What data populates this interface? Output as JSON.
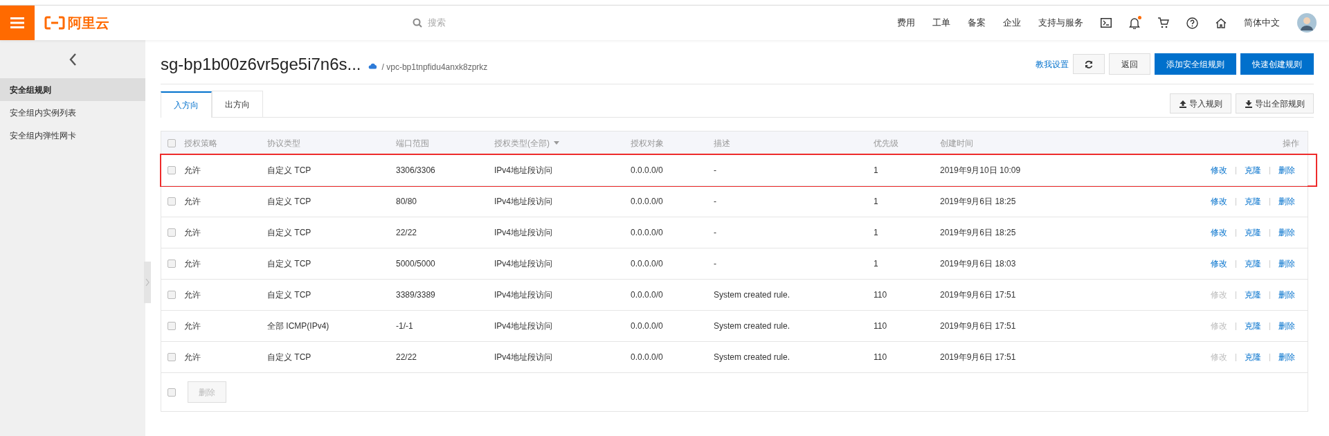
{
  "topbar": {
    "logo": "阿里云",
    "search_placeholder": "搜索",
    "nav": [
      "费用",
      "工单",
      "备案",
      "企业",
      "支持与服务"
    ],
    "notification_dot": true,
    "language": "简体中文"
  },
  "sidebar": {
    "items": [
      {
        "label": "安全组规则",
        "selected": true
      },
      {
        "label": "安全组内实例列表",
        "selected": false
      },
      {
        "label": "安全组内弹性网卡",
        "selected": false
      }
    ]
  },
  "header": {
    "title": "sg-bp1b00z6vr5ge5i7n6s...",
    "vpc": "/ vpc-bp1tnpfidu4anxk8zprkz",
    "help_link": "教我设置",
    "buttons": [
      {
        "label": "返回",
        "kind": "plain"
      },
      {
        "label": "添加安全组规则",
        "kind": "primary"
      },
      {
        "label": "快速创建规则",
        "kind": "primary"
      }
    ]
  },
  "tabs": [
    {
      "label": "入方向",
      "selected": true
    },
    {
      "label": "出方向",
      "selected": false
    }
  ],
  "tools": [
    {
      "label": "导入规则",
      "kind": "upload"
    },
    {
      "label": "导出全部规则",
      "kind": "download"
    }
  ],
  "table": {
    "select_all_checked": false,
    "columns": [
      "授权策略",
      "协议类型",
      "端口范围",
      "授权类型(全部)",
      "授权对象",
      "描述",
      "优先级",
      "创建时间",
      "操作"
    ],
    "rows": [
      {
        "checked": false,
        "highlighted": true,
        "cells": [
          "允许",
          "自定义 TCP",
          "3306/3306",
          "IPv4地址段访问",
          "0.0.0.0/0",
          "-",
          "1",
          "2019年9月10日 10:09"
        ],
        "actions": [
          {
            "label": "修改",
            "disabled": false
          },
          {
            "label": "克隆",
            "disabled": false
          },
          {
            "label": "删除",
            "disabled": false
          }
        ]
      },
      {
        "checked": false,
        "highlighted": false,
        "cells": [
          "允许",
          "自定义 TCP",
          "80/80",
          "IPv4地址段访问",
          "0.0.0.0/0",
          "-",
          "1",
          "2019年9月6日 18:25"
        ],
        "actions": [
          {
            "label": "修改",
            "disabled": false
          },
          {
            "label": "克隆",
            "disabled": false
          },
          {
            "label": "删除",
            "disabled": false
          }
        ]
      },
      {
        "checked": false,
        "highlighted": false,
        "cells": [
          "允许",
          "自定义 TCP",
          "22/22",
          "IPv4地址段访问",
          "0.0.0.0/0",
          "-",
          "1",
          "2019年9月6日 18:25"
        ],
        "actions": [
          {
            "label": "修改",
            "disabled": false
          },
          {
            "label": "克隆",
            "disabled": false
          },
          {
            "label": "删除",
            "disabled": false
          }
        ]
      },
      {
        "checked": false,
        "highlighted": false,
        "cells": [
          "允许",
          "自定义 TCP",
          "5000/5000",
          "IPv4地址段访问",
          "0.0.0.0/0",
          "-",
          "1",
          "2019年9月6日 18:03"
        ],
        "actions": [
          {
            "label": "修改",
            "disabled": false
          },
          {
            "label": "克隆",
            "disabled": false
          },
          {
            "label": "删除",
            "disabled": false
          }
        ]
      },
      {
        "checked": false,
        "highlighted": false,
        "cells": [
          "允许",
          "自定义 TCP",
          "3389/3389",
          "IPv4地址段访问",
          "0.0.0.0/0",
          "System created rule.",
          "110",
          "2019年9月6日 17:51"
        ],
        "actions": [
          {
            "label": "修改",
            "disabled": true
          },
          {
            "label": "克隆",
            "disabled": false
          },
          {
            "label": "删除",
            "disabled": false
          }
        ]
      },
      {
        "checked": false,
        "highlighted": false,
        "cells": [
          "允许",
          "全部 ICMP(IPv4)",
          "-1/-1",
          "IPv4地址段访问",
          "0.0.0.0/0",
          "System created rule.",
          "110",
          "2019年9月6日 17:51"
        ],
        "actions": [
          {
            "label": "修改",
            "disabled": true
          },
          {
            "label": "克隆",
            "disabled": false
          },
          {
            "label": "删除",
            "disabled": false
          }
        ]
      },
      {
        "checked": false,
        "highlighted": false,
        "cells": [
          "允许",
          "自定义 TCP",
          "22/22",
          "IPv4地址段访问",
          "0.0.0.0/0",
          "System created rule.",
          "110",
          "2019年9月6日 17:51"
        ],
        "actions": [
          {
            "label": "修改",
            "disabled": true
          },
          {
            "label": "克隆",
            "disabled": false
          },
          {
            "label": "删除",
            "disabled": false
          }
        ]
      }
    ],
    "footer_checked": false,
    "footer_button": {
      "label": "删除",
      "disabled": true
    }
  }
}
